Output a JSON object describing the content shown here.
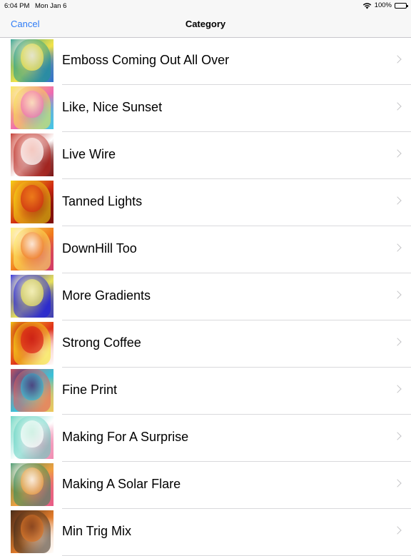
{
  "status_bar": {
    "time": "6:04 PM",
    "date": "Mon Jan 6",
    "battery": "100%"
  },
  "nav": {
    "cancel_label": "Cancel",
    "title": "Category"
  },
  "categories": [
    {
      "label": "Emboss Coming Out All Over",
      "icon": "emboss-thumbnail",
      "colors": [
        "#1a9a8a",
        "#f2e24a",
        "#2a6fd0",
        "#e8e8e8"
      ]
    },
    {
      "label": "Like, Nice Sunset",
      "icon": "sunset-thumbnail",
      "colors": [
        "#f7e84a",
        "#f06ab0",
        "#3fc8e6",
        "#fff3c0"
      ]
    },
    {
      "label": "Live Wire",
      "icon": "live-wire-thumbnail",
      "colors": [
        "#b8241c",
        "#ffffff",
        "#7a1010",
        "#f5c2b8"
      ]
    },
    {
      "label": "Tanned Lights",
      "icon": "tanned-lights-thumbnail",
      "colors": [
        "#f5e414",
        "#d02a12",
        "#7a0d07",
        "#f48c1c"
      ]
    },
    {
      "label": "DownHill Too",
      "icon": "downhill-thumbnail",
      "colors": [
        "#fff36a",
        "#f07a1a",
        "#d23a6a",
        "#ffffff"
      ]
    },
    {
      "label": "More Gradients",
      "icon": "gradients-thumbnail",
      "colors": [
        "#1212e6",
        "#e8e25a",
        "#3a3ab8",
        "#faf6c8"
      ]
    },
    {
      "label": "Strong Coffee",
      "icon": "strong-coffee-thumbnail",
      "colors": [
        "#f6e81a",
        "#e0301a",
        "#ffffff",
        "#c81a10"
      ]
    },
    {
      "label": "Fine Print",
      "icon": "fine-print-thumbnail",
      "colors": [
        "#e85a5a",
        "#3ac0d8",
        "#f2c85a",
        "#4a2a70"
      ]
    },
    {
      "label": "Making For A Surprise",
      "icon": "surprise-thumbnail",
      "colors": [
        "#5ad0c0",
        "#ffffff",
        "#f08ab0",
        "#c8f0e0"
      ]
    },
    {
      "label": "Making A Solar Flare",
      "icon": "solar-flare-thumbnail",
      "colors": [
        "#2a8a5a",
        "#f0a040",
        "#e85a8a",
        "#ffffff"
      ]
    },
    {
      "label": "Min Trig Mix",
      "icon": "min-trig-thumbnail",
      "colors": [
        "#3a2a1a",
        "#e07a2a",
        "#ffffff",
        "#7a3a1a"
      ]
    }
  ]
}
